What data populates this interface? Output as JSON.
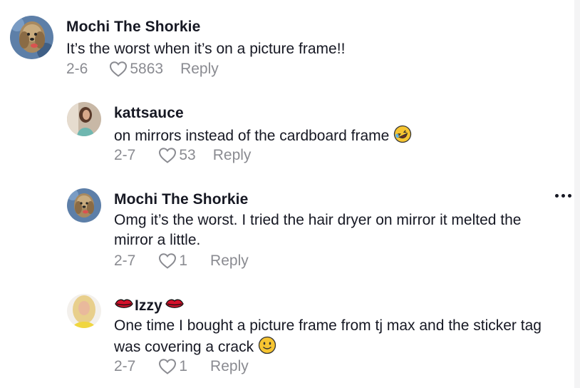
{
  "comments": [
    {
      "username": "Mochi The Shorkie",
      "text_lines": [
        "It’s the worst when it’s on a picture frame!!"
      ],
      "date": "2-6",
      "likes": "5863",
      "reply": "Reply",
      "avatar": "dog-avatar"
    },
    {
      "username": "kattsauce",
      "text_lines": [
        "on mirrors instead of the cardboard frame"
      ],
      "emoji": "rolling-laughing-emoji",
      "date": "2-7",
      "likes": "53",
      "reply": "Reply",
      "avatar": "person-avatar"
    },
    {
      "username": "Mochi The Shorkie",
      "text_lines": [
        "Omg it’s the worst. I tried the hair dryer on mirror it melted the",
        "mirror a little."
      ],
      "date": "2-7",
      "likes": "1",
      "reply": "Reply",
      "avatar": "dog-avatar"
    },
    {
      "username": "Izzy",
      "username_decoration": "lips-emoji",
      "text_lines": [
        "One time I bought a picture frame from tj max and the sticker tag",
        "was covering a crack"
      ],
      "emoji": "slightly-smiling-emoji",
      "date": "2-7",
      "likes": "1",
      "reply": "Reply",
      "avatar": "blonde-person-avatar"
    }
  ],
  "colors": {
    "text": "#161823",
    "meta": "#8a8b91"
  }
}
